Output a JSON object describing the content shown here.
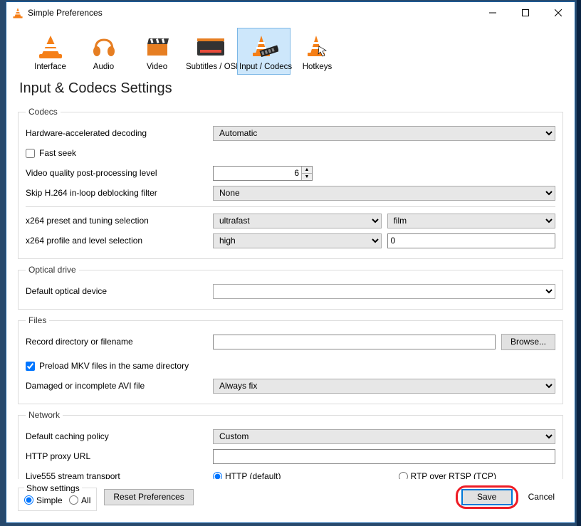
{
  "window": {
    "title": "Simple Preferences"
  },
  "tabs": {
    "interface": "Interface",
    "audio": "Audio",
    "video": "Video",
    "subtitles": "Subtitles / OSD",
    "input_codecs": "Input / Codecs",
    "hotkeys": "Hotkeys"
  },
  "heading": "Input & Codecs Settings",
  "groups": {
    "codecs": {
      "legend": "Codecs",
      "hw_decoding_label": "Hardware-accelerated decoding",
      "hw_decoding_value": "Automatic",
      "fast_seek_label": "Fast seek",
      "fast_seek_checked": false,
      "postproc_label": "Video quality post-processing level",
      "postproc_value": "6",
      "skip_h264_label": "Skip H.264 in-loop deblocking filter",
      "skip_h264_value": "None",
      "x264_preset_label": "x264 preset and tuning selection",
      "x264_preset_value": "ultrafast",
      "x264_tune_value": "film",
      "x264_profile_label": "x264 profile and level selection",
      "x264_profile_value": "high",
      "x264_level_value": "0"
    },
    "optical": {
      "legend": "Optical drive",
      "default_device_label": "Default optical device",
      "default_device_value": ""
    },
    "files": {
      "legend": "Files",
      "record_dir_label": "Record directory or filename",
      "record_dir_value": "",
      "browse_label": "Browse...",
      "preload_mkv_label": "Preload MKV files in the same directory",
      "preload_mkv_checked": true,
      "damaged_avi_label": "Damaged or incomplete AVI file",
      "damaged_avi_value": "Always fix"
    },
    "network": {
      "legend": "Network",
      "caching_label": "Default caching policy",
      "caching_value": "Custom",
      "proxy_label": "HTTP proxy URL",
      "proxy_value": "",
      "live555_label": "Live555 stream transport",
      "live555_http": "HTTP (default)",
      "live555_rtp": "RTP over RTSP (TCP)"
    }
  },
  "footer": {
    "show_settings_legend": "Show settings",
    "simple_label": "Simple",
    "all_label": "All",
    "reset_label": "Reset Preferences",
    "save_label": "Save",
    "cancel_label": "Cancel"
  }
}
